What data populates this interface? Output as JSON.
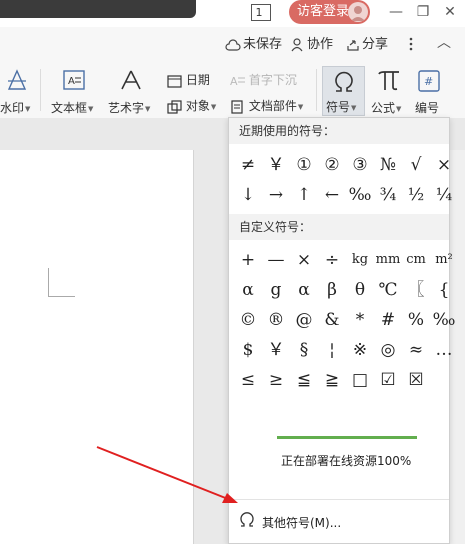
{
  "titlebar": {
    "window_count": "1",
    "login_label": "访客登录",
    "controls": {
      "minimize": "—",
      "restore": "❐",
      "close": "✕"
    }
  },
  "actionbar": {
    "unsaved": "未保存",
    "collaborate": "协作",
    "share": "分享"
  },
  "ribbon": {
    "watermark": "水印",
    "textbox": "文本框",
    "wordart": "艺术字",
    "date": "日期",
    "object": "对象",
    "dropcap": "首字下沉",
    "docparts": "文档部件",
    "symbol": "符号",
    "formula": "公式",
    "numbering": "编号"
  },
  "symbol_panel": {
    "recent_title": "近期使用的符号：",
    "recent_symbols": [
      "≠",
      "￥",
      "①",
      "②",
      "③",
      "№",
      "√",
      "×",
      "↓",
      "→",
      "↑",
      "←",
      "‰",
      "¾",
      "½",
      "¼"
    ],
    "custom_title": "自定义符号：",
    "custom_symbols": [
      "+",
      "—",
      "×",
      "÷",
      "kg",
      "mm",
      "cm",
      "m²",
      "α",
      "g",
      "α",
      "β",
      "θ",
      "℃",
      "〖",
      "{",
      "©",
      "®",
      "@",
      "&",
      "*",
      "#",
      "%",
      "‰",
      "$",
      "￥",
      "§",
      "¦",
      "※",
      "◎",
      "≈",
      "…",
      "≤",
      "≥",
      "≦",
      "≧",
      "□",
      "☑",
      "☒"
    ],
    "progress_fraction": 1.0,
    "progress_text": "正在部署在线资源100%",
    "more_label": "其他符号(M)..."
  },
  "colors": {
    "accent_login": "#d96a63",
    "progress_green": "#62ae4e",
    "arrow_red": "#e02020"
  }
}
